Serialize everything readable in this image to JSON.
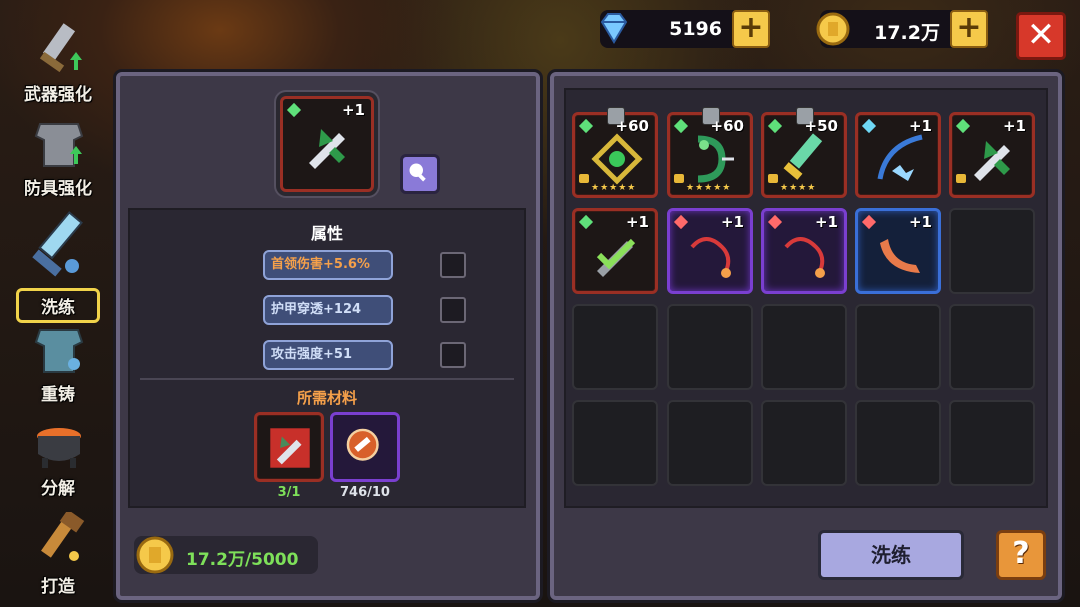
{
  "resources": {
    "diamonds": "5196",
    "gold": "17.2万"
  },
  "nav": [
    {
      "label": "武器强化",
      "icon": "sword-upgrade-icon"
    },
    {
      "label": "防具强化",
      "icon": "armor-upgrade-icon"
    },
    {
      "label": "洗练",
      "icon": "refine-sword-icon",
      "active": true
    },
    {
      "label": "重铸",
      "icon": "reforge-armor-icon"
    },
    {
      "label": "分解",
      "icon": "cauldron-icon"
    },
    {
      "label": "打造",
      "icon": "forge-hammer-icon"
    }
  ],
  "selected_item": {
    "plus": "+1",
    "icon": "green-crossbow-icon"
  },
  "attributes": {
    "title": "属性",
    "items": [
      {
        "text": "首领伤害+5.6%"
      },
      {
        "text": "护甲穿透+124"
      },
      {
        "text": "攻击强度+51"
      }
    ]
  },
  "materials": {
    "title": "所需材料",
    "items": [
      {
        "count": "3/1",
        "icon": "crossbow-material-icon"
      },
      {
        "count": "746/10",
        "icon": "refine-stone-icon"
      }
    ]
  },
  "cost": "17.2万/5000",
  "inventory": [
    {
      "plus": "+60",
      "rarity": "red",
      "gem": "#5fe07a",
      "icon": "gold-ring-icon",
      "locked": true,
      "stars": "★★★★★",
      "pinned": true
    },
    {
      "plus": "+60",
      "rarity": "red",
      "gem": "#5fe07a",
      "icon": "serpent-bow-icon",
      "locked": true,
      "stars": "★★★★★",
      "pinned": true
    },
    {
      "plus": "+50",
      "rarity": "red",
      "gem": "#5fe07a",
      "icon": "jade-sword-icon",
      "locked": true,
      "stars": "★★★★",
      "pinned": true
    },
    {
      "plus": "+1",
      "rarity": "red",
      "gem": "#6fd8f5",
      "icon": "ice-bow-icon",
      "locked": false,
      "stars": "",
      "pinned": false
    },
    {
      "plus": "+1",
      "rarity": "red",
      "gem": "#5fe07a",
      "icon": "green-crossbow-icon",
      "locked": true,
      "stars": "",
      "pinned": false
    },
    {
      "plus": "+1",
      "rarity": "red",
      "gem": "#5fe07a",
      "icon": "checked-crossbow-icon",
      "locked": false,
      "stars": "",
      "pinned": false
    },
    {
      "plus": "+1",
      "rarity": "purple",
      "gem": "#ff6a6a",
      "icon": "red-whip-icon",
      "locked": false,
      "stars": "",
      "pinned": false
    },
    {
      "plus": "+1",
      "rarity": "purple",
      "gem": "#ff6a6a",
      "icon": "red-whip-icon",
      "locked": false,
      "stars": "",
      "pinned": false
    },
    {
      "plus": "+1",
      "rarity": "blue",
      "gem": "#ff6a6a",
      "icon": "boomerang-icon",
      "locked": false,
      "stars": "",
      "pinned": false
    }
  ],
  "buttons": {
    "refine": "洗练",
    "help": "?"
  }
}
